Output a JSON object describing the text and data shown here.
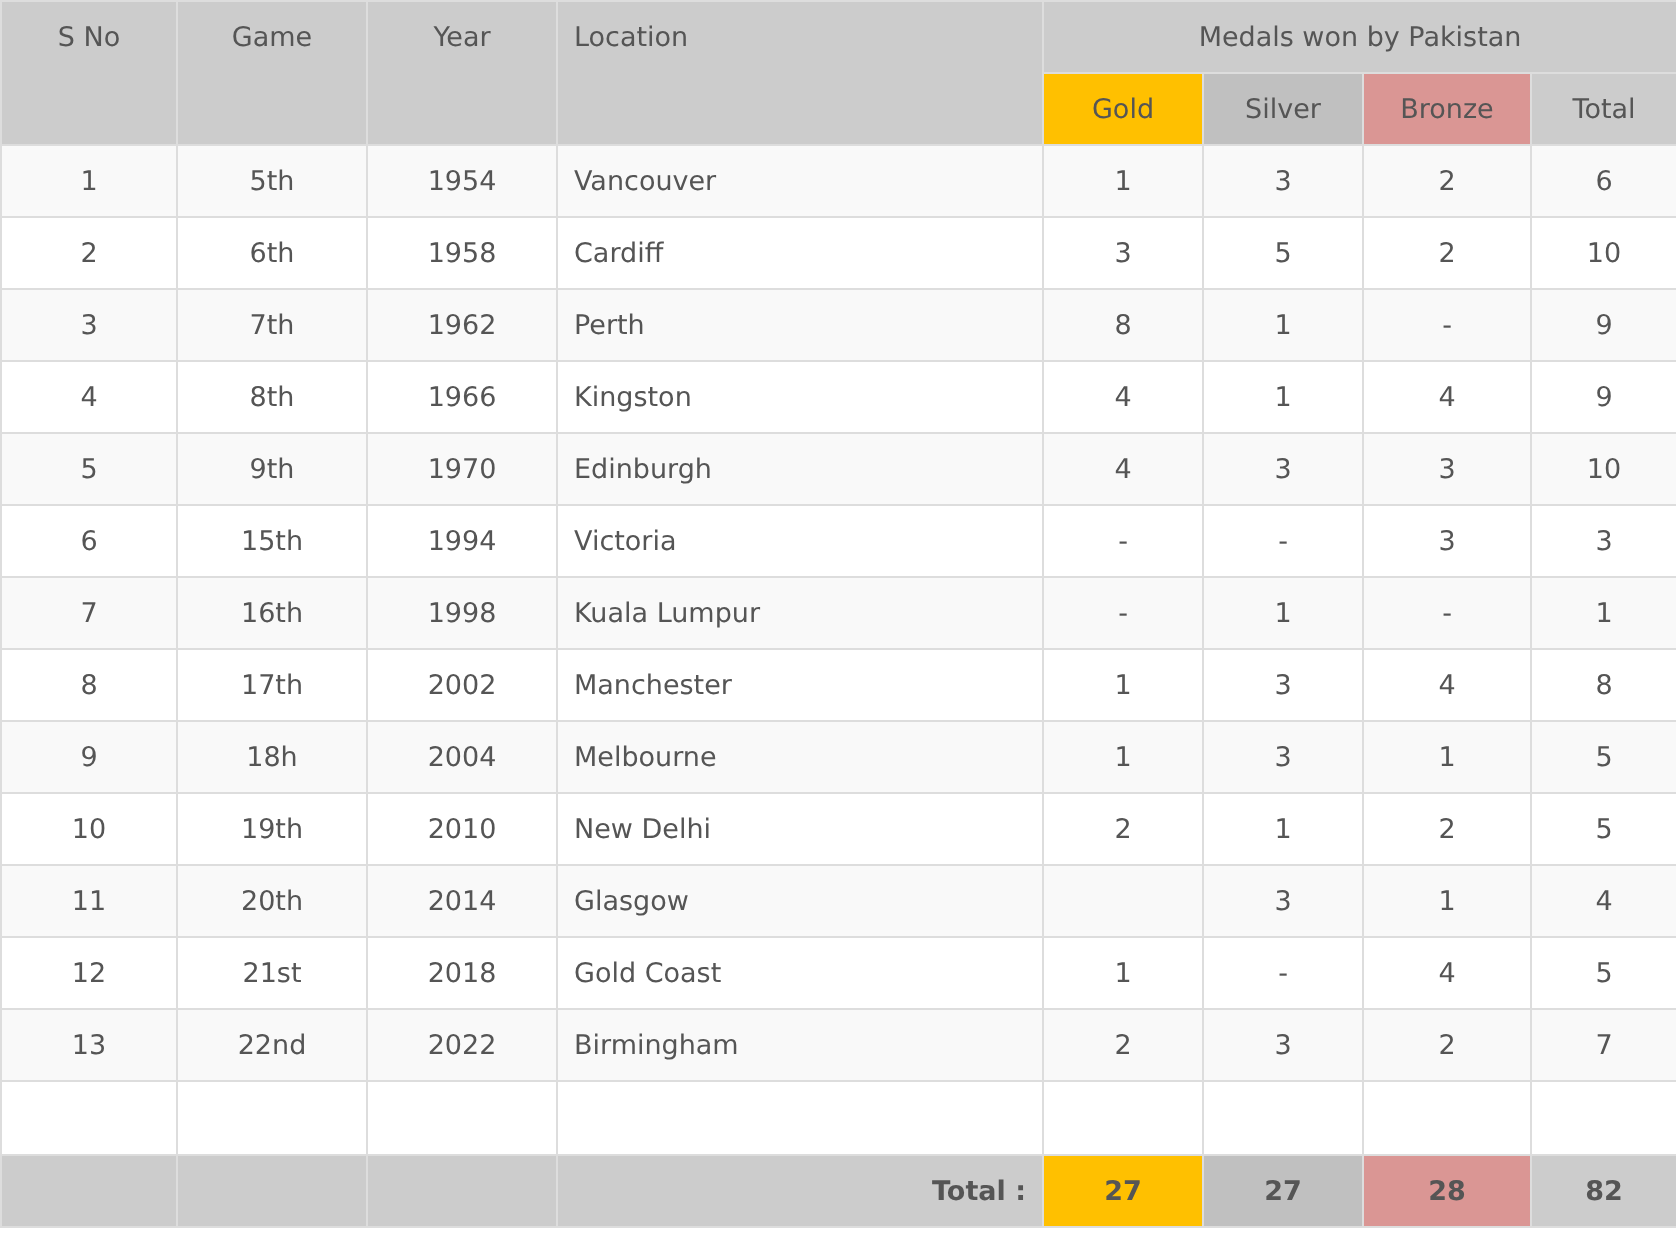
{
  "table": {
    "columns": [
      {
        "label": "S No"
      },
      {
        "label": "Game"
      },
      {
        "label": "Year"
      },
      {
        "label": "Location"
      }
    ],
    "group_header": "Medals won by Pakistan",
    "medal_columns": [
      {
        "label": "Gold",
        "color": "#ffc000"
      },
      {
        "label": "Silver",
        "color": "#c0c0c0"
      },
      {
        "label": "Bronze",
        "color": "#da9694"
      },
      {
        "label": "Total"
      }
    ],
    "rows": [
      [
        "1",
        "5th",
        "1954",
        "Vancouver",
        "1",
        "3",
        "2",
        "6"
      ],
      [
        "2",
        "6th",
        "1958",
        "Cardiff",
        "3",
        "5",
        "2",
        "10"
      ],
      [
        "3",
        "7th",
        "1962",
        "Perth",
        "8",
        "1",
        "-",
        "9"
      ],
      [
        "4",
        "8th",
        "1966",
        "Kingston",
        "4",
        "1",
        "4",
        "9"
      ],
      [
        "5",
        "9th",
        "1970",
        "Edinburgh",
        "4",
        "3",
        "3",
        "10"
      ],
      [
        "6",
        "15th",
        "1994",
        "Victoria",
        "-",
        "-",
        "3",
        "3"
      ],
      [
        "7",
        "16th",
        "1998",
        "Kuala Lumpur",
        "-",
        "1",
        "-",
        "1"
      ],
      [
        "8",
        "17th",
        "2002",
        "Manchester",
        "1",
        "3",
        "4",
        "8"
      ],
      [
        "9",
        "18h",
        "2004",
        "Melbourne",
        "1",
        "3",
        "1",
        "5"
      ],
      [
        "10",
        "19th",
        "2010",
        "New Delhi",
        "2",
        "1",
        "2",
        "5"
      ],
      [
        "11",
        "20th",
        "2014",
        "Glasgow",
        null,
        "3",
        "1",
        "4"
      ],
      [
        "12",
        "21st",
        "2018",
        "Gold Coast",
        "1",
        "-",
        "4",
        "5"
      ],
      [
        "13",
        "22nd",
        "2022",
        "Birmingham",
        "2",
        "3",
        "2",
        "7"
      ]
    ],
    "footer": {
      "label": "Total :",
      "values": [
        "27",
        "27",
        "28",
        "82"
      ]
    }
  }
}
